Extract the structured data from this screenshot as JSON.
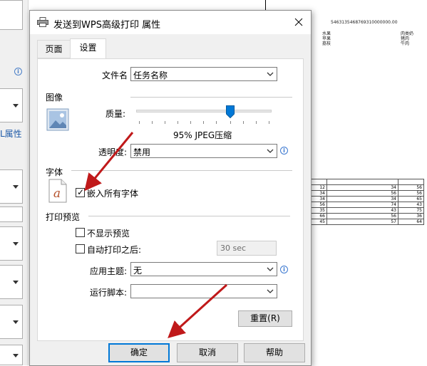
{
  "dialog": {
    "title": "发送到WPS高级打印 属性",
    "tabs": [
      {
        "label": "页面",
        "active": false
      },
      {
        "label": "设置",
        "active": true
      }
    ],
    "filename": {
      "label": "文件名",
      "value": "任务名称"
    },
    "image_section": {
      "heading": "图像",
      "quality_label": "质量:",
      "quality_value_text": "95% JPEG压缩",
      "quality_percent": 95,
      "transparency_label": "透明度:",
      "transparency_value": "禁用"
    },
    "font_section": {
      "heading": "字体",
      "embed_fonts_label": "嵌入所有字体",
      "embed_fonts_checked": true
    },
    "preview_section": {
      "heading": "打印预览",
      "no_preview_label": "不显示预览",
      "no_preview_checked": false,
      "auto_print_label": "自动打印之后:",
      "auto_print_checked": false,
      "auto_print_delay": "30 sec",
      "theme_label": "应用主题:",
      "theme_value": "无",
      "script_label": "运行脚本:",
      "script_value": ""
    },
    "reset_button": "重置(R)",
    "ok_button": "确定",
    "cancel_button": "取消",
    "help_button": "帮助"
  },
  "background_app": {
    "left_fragment_text": "L属性",
    "document_number": "5463135468769310000000.00",
    "doc_col1": [
      "水果",
      "苹果",
      "荔枝"
    ],
    "doc_col2": [
      "肉类奶",
      "猪肉",
      "牛肉"
    ],
    "table_rows": [
      [
        "12",
        "34",
        "56"
      ],
      [
        "34",
        "56",
        "56"
      ],
      [
        "34",
        "34",
        "65"
      ],
      [
        "56",
        "74",
        "43"
      ],
      [
        "35",
        "43",
        "75"
      ],
      [
        "66",
        "56",
        "36"
      ],
      [
        "45",
        "57",
        "64"
      ]
    ]
  },
  "colors": {
    "accent": "#0078d7",
    "annotation_arrow": "#c0191a",
    "link_text": "#1e5aa8"
  }
}
